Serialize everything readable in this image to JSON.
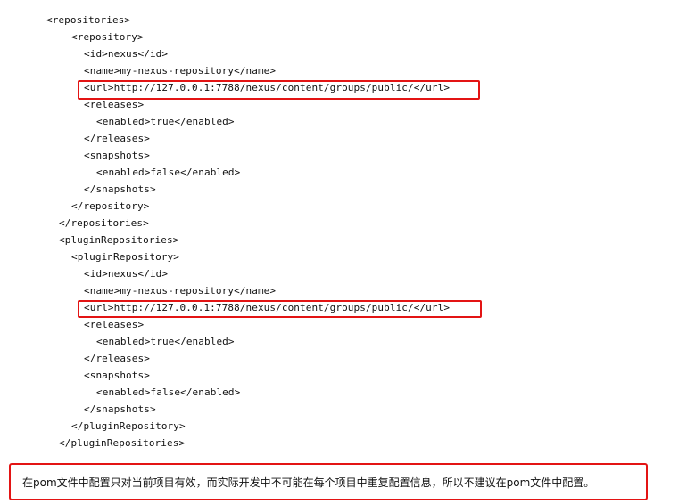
{
  "code": {
    "lines": [
      "<repositories>",
      "<repository>",
      "<id>nexus</id>",
      "<name>my-nexus-repository</name>",
      "<url>http://127.0.0.1:7788/nexus/content/groups/public/</url>",
      "<releases>",
      "<enabled>true</enabled>",
      "</releases>",
      "<snapshots>",
      "<enabled>false</enabled>",
      "</snapshots>",
      "</repository>",
      "</repositories>",
      "<pluginRepositories>",
      "<pluginRepository>",
      "<id>nexus</id>",
      "<name>my-nexus-repository</name>",
      "<url>http://127.0.0.1:7788/nexus/content/groups/public/</url>",
      "<releases>",
      "<enabled>true</enabled>",
      "</releases>",
      "<snapshots>",
      "<enabled>false</enabled>",
      "</snapshots>",
      "</pluginRepository>",
      "</pluginRepositories>"
    ]
  },
  "note": {
    "text": "在pom文件中配置只对当前项目有效，而实际开发中不可能在每个项目中重复配置信息，所以不建议在pom文件中配置。"
  },
  "highlight_color": "#e31414"
}
